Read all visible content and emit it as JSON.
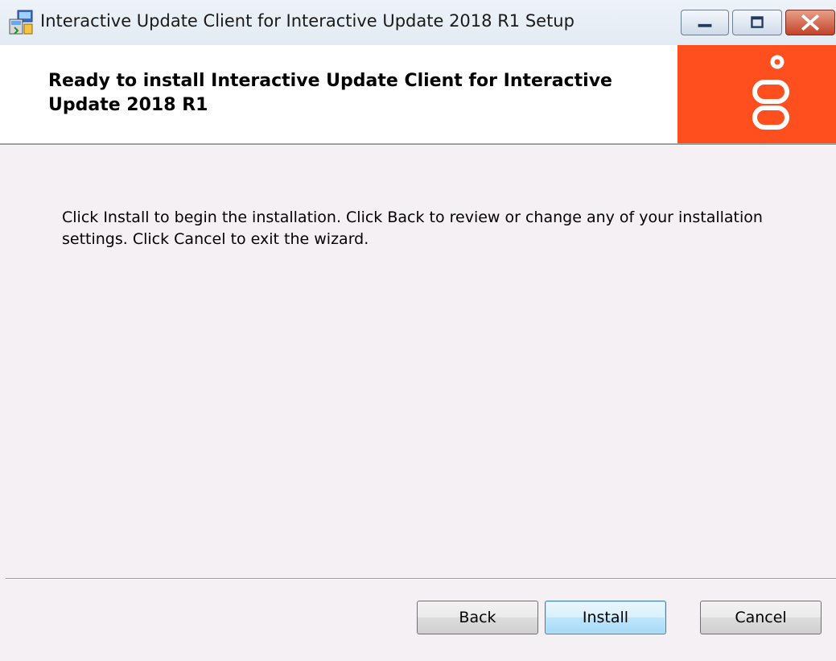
{
  "window": {
    "title": "Interactive Update Client for Interactive Update 2018 R1 Setup",
    "app_icon": "installer-icon"
  },
  "caption_buttons": {
    "minimize_icon": "minimize-icon",
    "maximize_icon": "maximize-icon",
    "close_icon": "close-icon"
  },
  "banner": {
    "heading": "Ready to install Interactive Update Client for Interactive Update 2018 R1",
    "logo": "genesys-logo",
    "logo_background": "#ff4f1f"
  },
  "main": {
    "instructions": "Click Install to begin the installation. Click Back to review or change any of your installation settings. Click Cancel to exit the wizard."
  },
  "footer": {
    "back_label": "Back",
    "install_label": "Install",
    "cancel_label": "Cancel"
  },
  "colors": {
    "window_background": "#f4f0f4",
    "default_button_border": "#3c7fb1"
  }
}
